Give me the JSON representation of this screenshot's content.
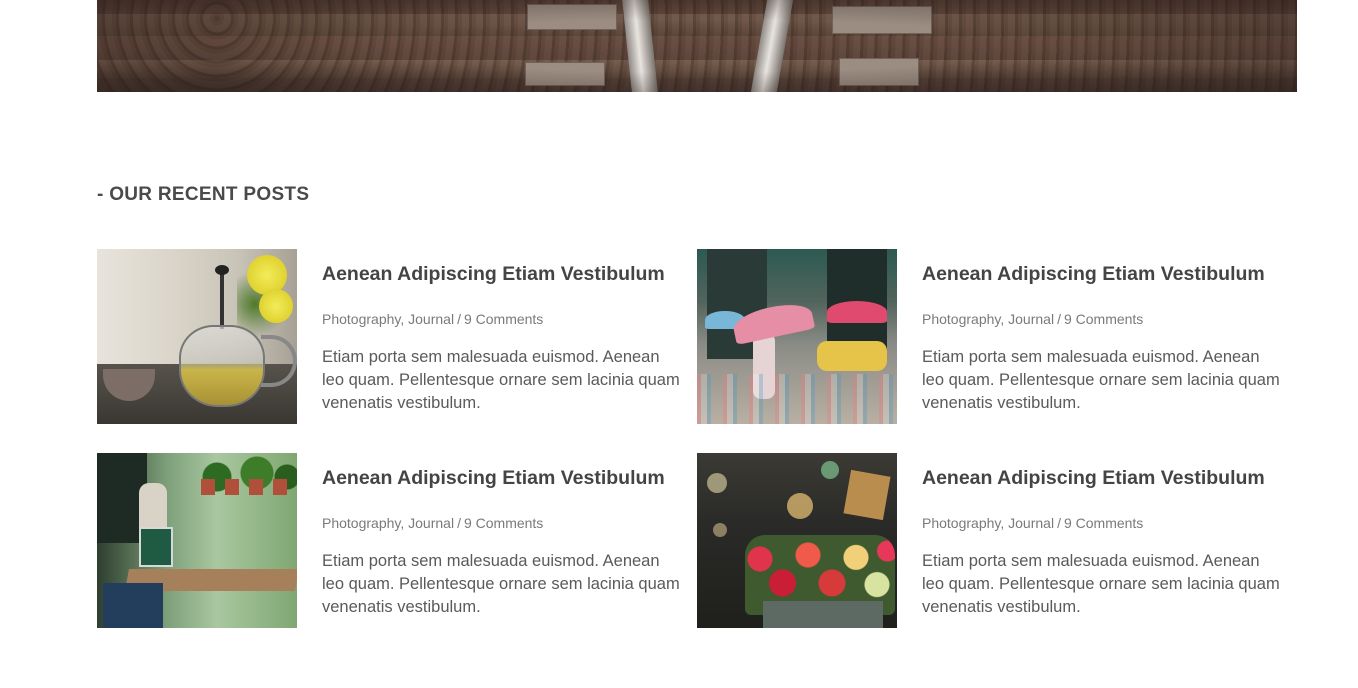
{
  "hero": {
    "image": "railway-tracks-photo"
  },
  "section": {
    "title": "- OUR RECENT POSTS"
  },
  "posts": [
    {
      "title": "Aenean Adipiscing Etiam Vestibulum",
      "categories": [
        "Photography",
        "Journal"
      ],
      "comments": "9 Comments",
      "excerpt": "Etiam porta sem malesuada euismod. Aenean leo quam. Pellentesque ornare sem lacinia quam venenatis vestibulum.",
      "image": "tea-press-photo"
    },
    {
      "title": "Aenean Adipiscing Etiam Vestibulum",
      "categories": [
        "Photography",
        "Journal"
      ],
      "comments": "9 Comments",
      "excerpt": "Etiam porta sem malesuada euismod. Aenean leo quam. Pellentesque ornare sem lacinia quam venenatis vestibulum.",
      "image": "rainy-street-umbrellas-photo"
    },
    {
      "title": "Aenean Adipiscing Etiam Vestibulum",
      "categories": [
        "Photography",
        "Journal"
      ],
      "comments": "9 Comments",
      "excerpt": "Etiam porta sem malesuada euismod. Aenean leo quam. Pellentesque ornare sem lacinia quam venenatis vestibulum.",
      "image": "cafe-interior-photo"
    },
    {
      "title": "Aenean Adipiscing Etiam Vestibulum",
      "categories": [
        "Photography",
        "Journal"
      ],
      "comments": "9 Comments",
      "excerpt": "Etiam porta sem malesuada euismod. Aenean leo quam. Pellentesque ornare sem lacinia quam venenatis vestibulum.",
      "image": "flower-bouquet-night-photo"
    }
  ]
}
